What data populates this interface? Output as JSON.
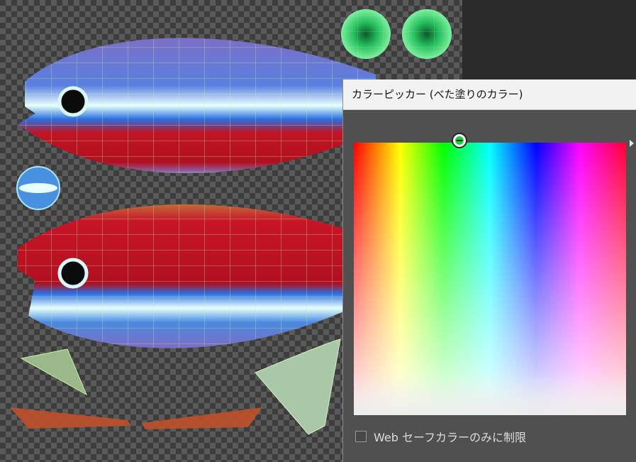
{
  "picker": {
    "title": "カラーピッカー (べた塗りのカラー)",
    "websafe_label": "Web セーフカラーのみに制限",
    "websafe_checked": false,
    "selected_hue_color": "#22cc44"
  },
  "canvas": {
    "content": "neon tetra fish UV texture on transparent checkerboard"
  },
  "colors": {
    "checker_dark": "#3c3c3c",
    "checker_light": "#5a5a5a",
    "dialog_bg": "#505050",
    "title_bg": "#f2f2f2"
  }
}
